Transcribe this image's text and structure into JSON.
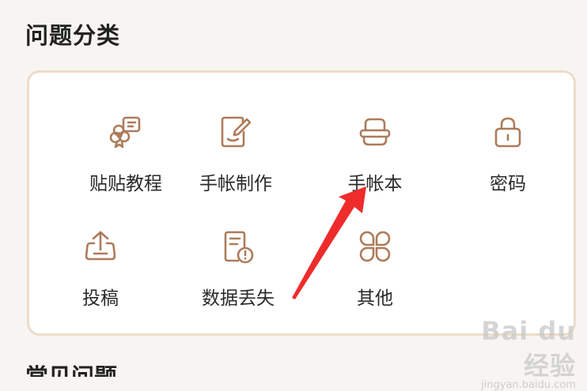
{
  "section": {
    "title": "问题分类"
  },
  "categories": [
    {
      "label": "贴贴教程",
      "icon": "sticker-tutorial-icon"
    },
    {
      "label": "手帐制作",
      "icon": "edit-note-icon"
    },
    {
      "label": "手帐本",
      "icon": "notebook-icon"
    },
    {
      "label": "密码",
      "icon": "lock-icon"
    },
    {
      "label": "投稿",
      "icon": "upload-icon"
    },
    {
      "label": "数据丢失",
      "icon": "data-loss-icon"
    },
    {
      "label": "其他",
      "icon": "more-apps-icon"
    }
  ],
  "next_section": {
    "title": "常见问题"
  },
  "watermark": {
    "logo_text": "Bai du 经验",
    "url": "jingyan.baidu.com"
  },
  "colors": {
    "icon": "#ad7b5a",
    "border": "#eddccb",
    "annotation_arrow": "#ee2c2c"
  }
}
